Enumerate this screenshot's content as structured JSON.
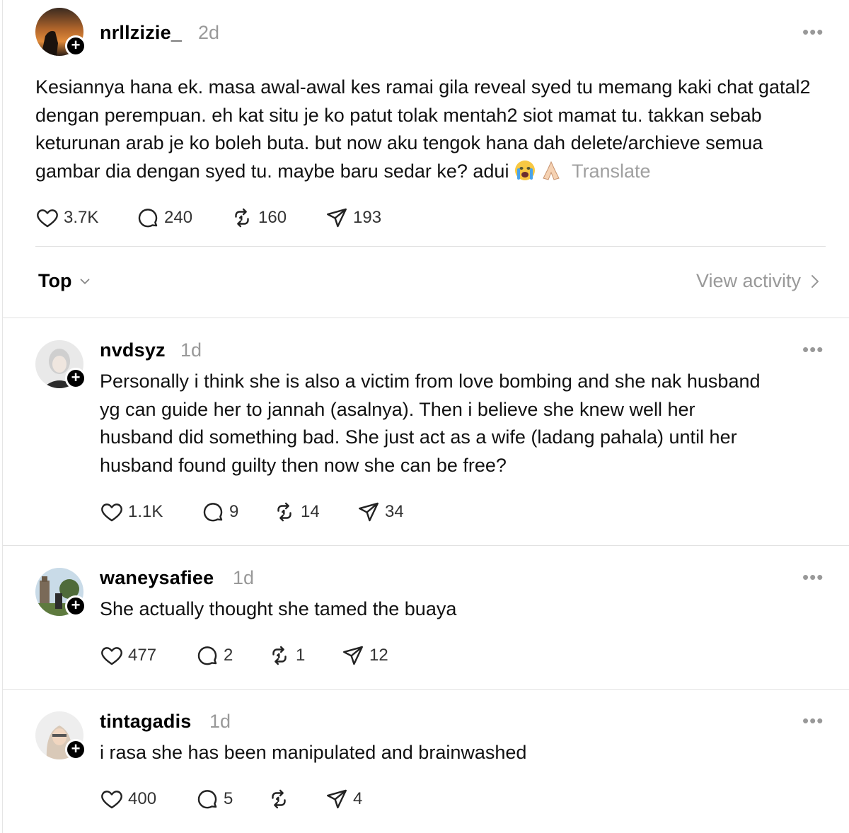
{
  "post": {
    "username": "nrllzizie_",
    "time": "2d",
    "text": "Kesiannya hana ek. masa awal-awal kes ramai gila reveal syed tu memang kaki chat gatal2 dengan perempuan. eh kat situ je ko patut tolak mentah2 siot mamat tu. takkan sebab keturunan arab je ko boleh buta. but now aku tengok hana dah delete/archieve semua gambar dia dengan syed tu. maybe baru sedar ke? adui",
    "emojis": [
      "crying-face-emoji",
      "folded-hands-emoji"
    ],
    "translate_label": "Translate",
    "likes": "3.7K",
    "replies": "240",
    "reposts": "160",
    "shares": "193"
  },
  "sort": {
    "label": "Top",
    "view_activity": "View activity"
  },
  "comments": [
    {
      "username": "nvdsyz",
      "time": "1d",
      "text": "Personally i think she is also a victim from love bombing and she nak husband yg can guide her to jannah (asalnya). Then i believe she knew well her husband did something bad. She just act as a wife (ladang pahala) until her husband found guilty then now she can be free?",
      "likes": "1.1K",
      "replies": "9",
      "reposts": "14",
      "shares": "34"
    },
    {
      "username": "waneysafiee",
      "time": "1d",
      "text": "She actually thought she tamed the buaya",
      "likes": "477",
      "replies": "2",
      "reposts": "1",
      "shares": "12"
    },
    {
      "username": "tintagadis",
      "time": "1d",
      "text": "i rasa she has been manipulated and brainwashed",
      "likes": "400",
      "replies": "5",
      "reposts": "",
      "shares": "4"
    }
  ],
  "more_label": "•••",
  "plus_label": "+",
  "colors": {
    "text": "#000000",
    "muted": "#999999",
    "divider": "#e2e2e2"
  }
}
